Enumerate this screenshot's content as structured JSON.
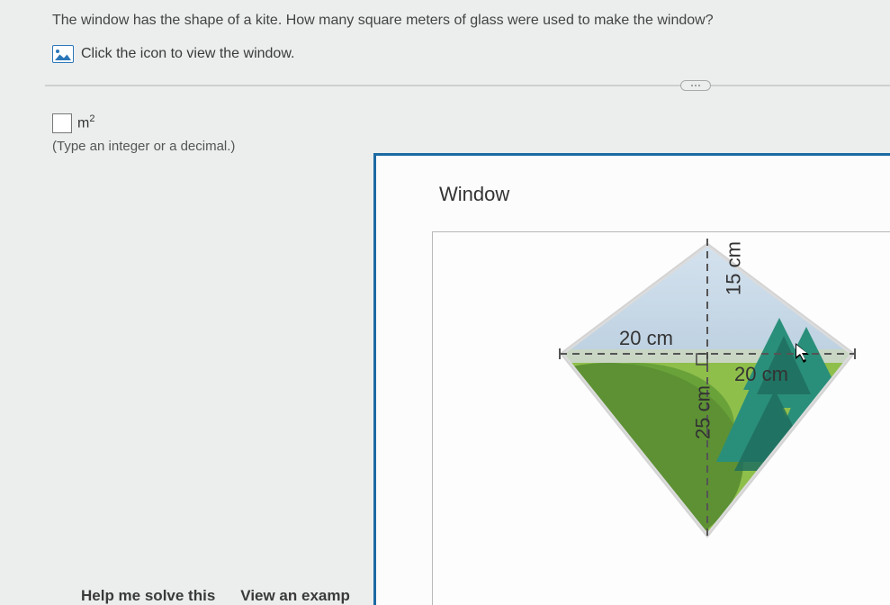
{
  "question": "The window has the shape of a kite. How many square meters of glass were used to make the window?",
  "icon_link_text": "Click the icon to view the window.",
  "answer": {
    "value": "",
    "unit_html": "m",
    "unit_exp": "2",
    "hint": "(Type an integer or a decimal.)"
  },
  "popup": {
    "title": "Window"
  },
  "kite": {
    "left_half": "20 cm",
    "right_half": "20 cm",
    "top_half": "15 cm",
    "bottom_half": "25 cm"
  },
  "chart_data": {
    "type": "diagram",
    "shape": "kite",
    "horizontal_diagonal_cm": 40,
    "vertical_diagonal_cm": 40,
    "segments": {
      "left_cm": 20,
      "right_cm": 20,
      "top_cm": 15,
      "bottom_cm": 25
    }
  },
  "footer": {
    "help": "Help me solve this",
    "example": "View an examp"
  }
}
